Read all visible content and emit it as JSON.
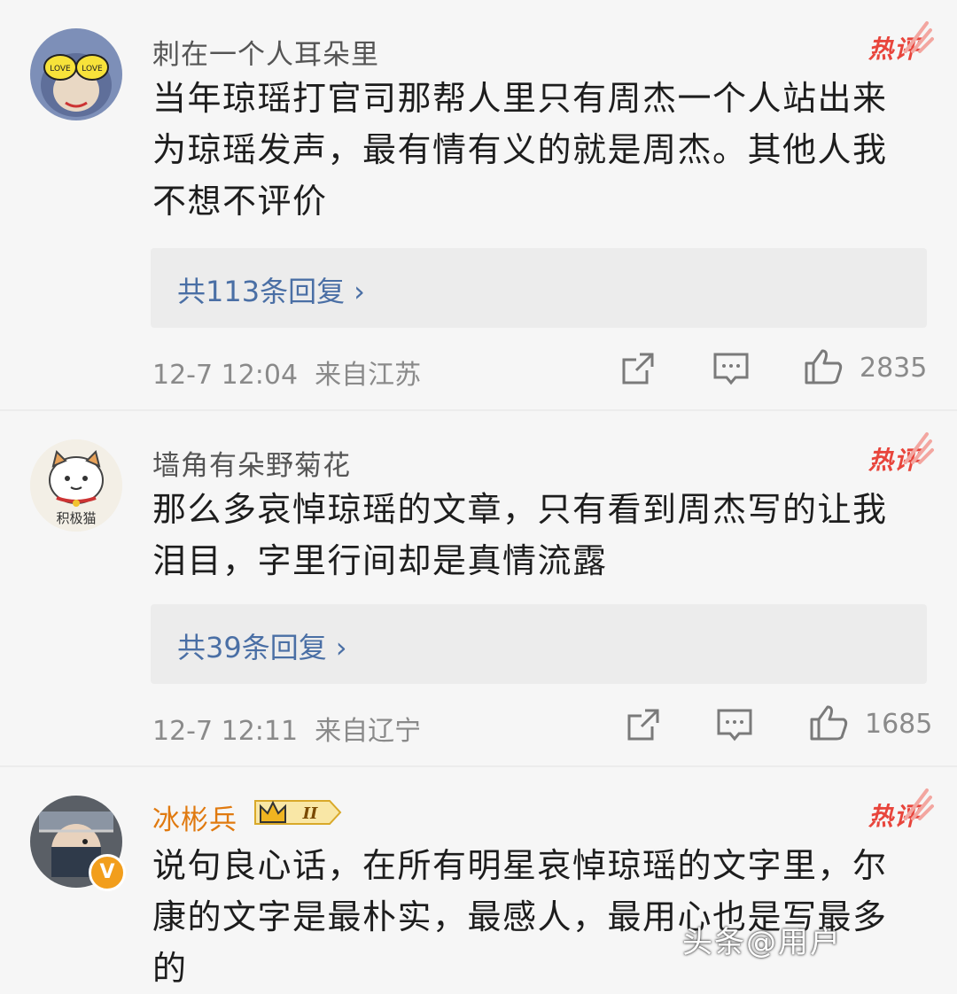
{
  "comments": [
    {
      "username": "刺在一个人耳朵里",
      "badge": "热评",
      "lines": [
        "当年琼瑶打官司那帮人里只有周杰一个人站出来",
        "为琼瑶发声，最有情有义的就是周杰。其他人我",
        "不想不评价"
      ],
      "replies": "共113条回复",
      "time": "12-7 12:04",
      "location": "来自江苏",
      "likes": "2835",
      "avatar_text": "LOVE LOVE"
    },
    {
      "username": "墙角有朵野菊花",
      "badge": "热评",
      "lines": [
        "那么多哀悼琼瑶的文章，只有看到周杰写的让我",
        "泪目，字里行间却是真情流露"
      ],
      "replies": "共39条回复",
      "time": "12-7 12:11",
      "location": "来自辽宁",
      "likes": "1685",
      "avatar_text": "积极猫"
    },
    {
      "username": "冰彬兵",
      "badge": "热评",
      "vip_level": "II",
      "verified_mark": "V",
      "lines": [
        "说句良心话，在所有明星哀悼琼瑶的文字里，尔",
        "康的文字是最朴实，最感人，最用心也是写最多",
        "的"
      ]
    }
  ],
  "icons": {
    "share": "share-icon",
    "comment": "comment-icon",
    "like": "thumbs-up-icon",
    "chevron": "chevron-right-icon"
  },
  "colors": {
    "hot": "#e8453c",
    "link": "#4a6fa5",
    "vip_name": "#e07a10"
  },
  "watermark": "头条@用户"
}
